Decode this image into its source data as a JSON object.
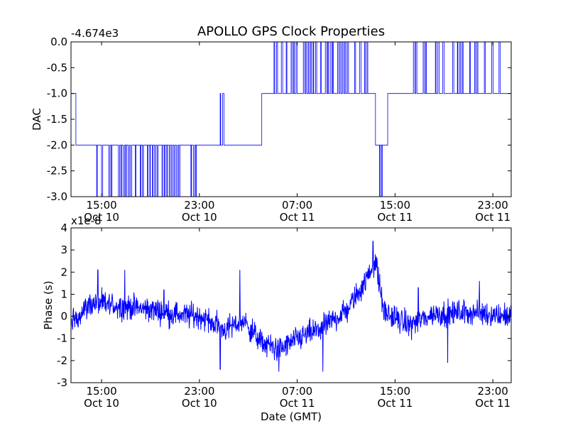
{
  "figure": {
    "title": "APOLLO GPS Clock Properties",
    "xlabel": "Date (GMT)",
    "colors": {
      "line": "#0000ff",
      "axes": "#000000",
      "background": "#ffffff"
    }
  },
  "chart_data": [
    {
      "type": "line",
      "title": "APOLLO GPS Clock Properties",
      "offset_label": "-4.674e3",
      "ylabel": "DAC",
      "xlabel": "",
      "ylim": [
        -3.0,
        0.0
      ],
      "y_ticks": [
        "-3.0",
        "-2.5",
        "-2.0",
        "-1.5",
        "-1.0",
        "-0.5",
        "0.0"
      ],
      "x_ticks": [
        {
          "time": "15:00",
          "date": "Oct 10"
        },
        {
          "time": "23:00",
          "date": "Oct 10"
        },
        {
          "time": "07:00",
          "date": "Oct 11"
        },
        {
          "time": "15:00",
          "date": "Oct 11"
        },
        {
          "time": "23:00",
          "date": "Oct 11"
        }
      ],
      "x_range_hours": [
        12.4,
        48.4
      ],
      "grid": false,
      "series": [
        {
          "description": "DAC value (offset -4674) stepping between discrete levels",
          "segments": [
            {
              "x_start": 12.4,
              "x_end": 12.8,
              "level_base": -1.0,
              "toggles": [
                -2.0,
                -1.0
              ]
            },
            {
              "x_start": 12.8,
              "x_end": 14.3,
              "level_base": -2.0,
              "toggles": []
            },
            {
              "x_start": 14.3,
              "x_end": 22.8,
              "level_base": -2.0,
              "toggles": [
                -3.0
              ]
            },
            {
              "x_start": 22.8,
              "x_end": 24.4,
              "level_base": -2.0,
              "toggles": []
            },
            {
              "x_start": 24.4,
              "x_end": 25.8,
              "level_base": -2.0,
              "toggles": [
                -1.0
              ]
            },
            {
              "x_start": 25.8,
              "x_end": 28.0,
              "level_base": -2.0,
              "toggles": []
            },
            {
              "x_start": 28.0,
              "x_end": 29.0,
              "level_base": -1.0,
              "toggles": []
            },
            {
              "x_start": 29.0,
              "x_end": 36.8,
              "level_base": -1.0,
              "toggles": [
                0.0
              ]
            },
            {
              "x_start": 36.8,
              "x_end": 37.3,
              "level_base": -1.0,
              "toggles": []
            },
            {
              "x_start": 37.3,
              "x_end": 38.3,
              "level_base": -2.0,
              "toggles": [
                -3.0
              ]
            },
            {
              "x_start": 38.3,
              "x_end": 40.0,
              "level_base": -1.0,
              "toggles": []
            },
            {
              "x_start": 40.0,
              "x_end": 47.8,
              "level_base": -1.0,
              "toggles": [
                0.0
              ]
            },
            {
              "x_start": 47.8,
              "x_end": 48.4,
              "level_base": -1.0,
              "toggles": []
            }
          ]
        }
      ]
    },
    {
      "type": "line",
      "offset_label": "x1e-8",
      "ylabel": "Phase (s)",
      "xlabel": "Date (GMT)",
      "ylim": [
        -3,
        4
      ],
      "y_ticks": [
        "-3",
        "-2",
        "-1",
        "0",
        "1",
        "2",
        "3",
        "4"
      ],
      "x_ticks": [
        {
          "time": "15:00",
          "date": "Oct 10"
        },
        {
          "time": "23:00",
          "date": "Oct 10"
        },
        {
          "time": "07:00",
          "date": "Oct 11"
        },
        {
          "time": "15:00",
          "date": "Oct 11"
        },
        {
          "time": "23:00",
          "date": "Oct 11"
        }
      ],
      "x_range_hours": [
        12.4,
        48.4
      ],
      "grid": false,
      "series": [
        {
          "description": "GPS clock phase (units 1e-8 s), noisy trace",
          "trend": [
            {
              "x": 12.4,
              "y": -0.3
            },
            {
              "x": 14.0,
              "y": 0.6
            },
            {
              "x": 16.0,
              "y": 0.5
            },
            {
              "x": 19.0,
              "y": 0.3
            },
            {
              "x": 21.0,
              "y": 0.1
            },
            {
              "x": 23.0,
              "y": 0.0
            },
            {
              "x": 25.0,
              "y": -0.6
            },
            {
              "x": 26.5,
              "y": -0.2
            },
            {
              "x": 28.0,
              "y": -1.2
            },
            {
              "x": 29.5,
              "y": -1.5
            },
            {
              "x": 31.0,
              "y": -1.0
            },
            {
              "x": 33.0,
              "y": -0.5
            },
            {
              "x": 35.0,
              "y": 0.3
            },
            {
              "x": 36.5,
              "y": 1.6
            },
            {
              "x": 37.3,
              "y": 2.5
            },
            {
              "x": 38.0,
              "y": 0.2
            },
            {
              "x": 40.0,
              "y": -0.4
            },
            {
              "x": 42.0,
              "y": 0.1
            },
            {
              "x": 45.0,
              "y": 0.2
            },
            {
              "x": 48.4,
              "y": 0.0
            }
          ],
          "noise_amplitude": 0.55,
          "spikes": [
            {
              "x": 14.6,
              "y": 2.1
            },
            {
              "x": 16.8,
              "y": 2.1
            },
            {
              "x": 20.0,
              "y": 1.2
            },
            {
              "x": 24.6,
              "y": -2.4
            },
            {
              "x": 26.2,
              "y": 2.1
            },
            {
              "x": 29.4,
              "y": -2.5
            },
            {
              "x": 33.0,
              "y": -2.5
            },
            {
              "x": 37.1,
              "y": 3.4
            },
            {
              "x": 40.8,
              "y": 1.3
            },
            {
              "x": 43.2,
              "y": -2.1
            },
            {
              "x": 45.8,
              "y": 1.6
            }
          ]
        }
      ]
    }
  ]
}
